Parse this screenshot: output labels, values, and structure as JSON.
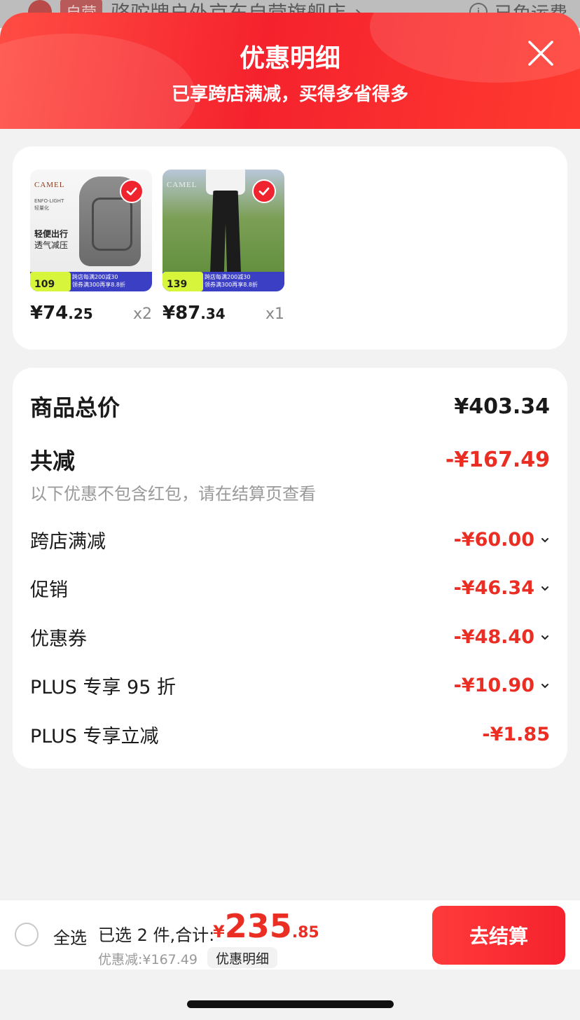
{
  "underlying": {
    "tag": "自营",
    "store_name": "骆驼牌户外京东自营旗舰店",
    "chevron": "›",
    "info_icon": "i",
    "shipping": "已免运费"
  },
  "header": {
    "title": "优惠明细",
    "subtitle": "已享跨店满减，买得多省得多"
  },
  "products": [
    {
      "brand": "CAMEL",
      "badge_line1": "ENFO·LIGHT",
      "badge_line2": "轻量化",
      "tagline1": "轻便出行",
      "tagline2": "透气减压",
      "bar_price": "109",
      "bar_text1": "跨店每满200减30",
      "bar_text2": "领券满300再享8.8折",
      "price_int": "¥74",
      "price_dec": ".25",
      "qty": "x2"
    },
    {
      "brand": "CAMEL",
      "bar_price": "139",
      "bar_text1": "跨店每满200减30",
      "bar_text2": "领券满300再享8.8折",
      "price_int": "¥87",
      "price_dec": ".34",
      "qty": "x1"
    }
  ],
  "summary": {
    "total_label": "商品总价",
    "total_value": "¥403.34",
    "reduce_label": "共减",
    "reduce_value": "-¥167.49",
    "note": "以下优惠不包含红包，请在结算页查看",
    "items": [
      {
        "label": "跨店满减",
        "value": "-¥60.00"
      },
      {
        "label": "促销",
        "value": "-¥46.34"
      },
      {
        "label": "优惠券",
        "value": "-¥48.40"
      },
      {
        "label": "PLUS 专享 95 折",
        "value": "-¥10.90"
      },
      {
        "label": "PLUS 专享立减",
        "value": "-¥1.85"
      }
    ]
  },
  "bottom": {
    "select_all": "全选",
    "selected_text": "已选 2 件,合计:",
    "currency": "¥",
    "total_int": "235",
    "total_dec": ".85",
    "discount_text": "优惠减:¥167.49",
    "detail_button": "优惠明细",
    "checkout_button": "去结算"
  },
  "colors": {
    "accent_red": "#ea2e24",
    "header_red": "#f5222d"
  }
}
